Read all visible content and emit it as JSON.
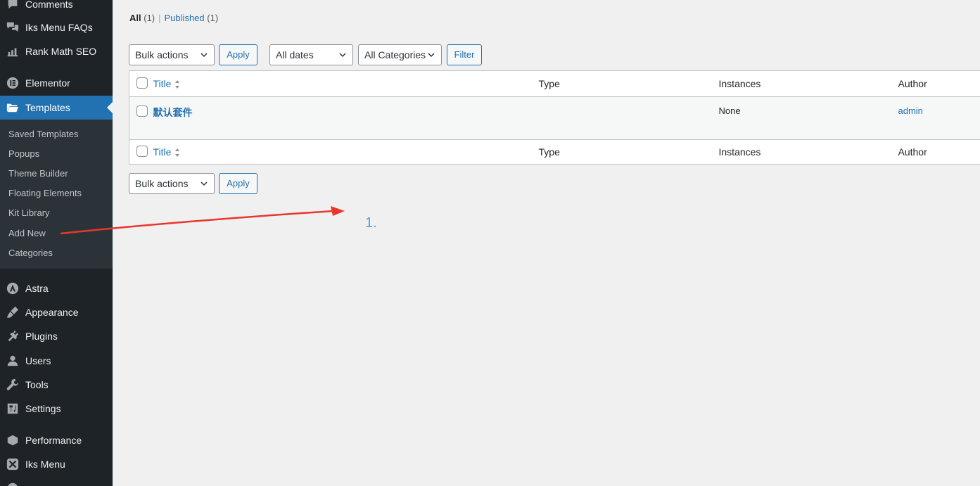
{
  "sidebar": {
    "top_items": [
      {
        "label": "Comments",
        "icon": "comment-icon"
      },
      {
        "label": "Iks Menu FAQs",
        "icon": "faq-icon"
      },
      {
        "label": "Rank Math SEO",
        "icon": "chart-icon"
      }
    ],
    "elementor": {
      "label": "Elementor",
      "icon": "elementor-icon"
    },
    "templates": {
      "label": "Templates",
      "icon": "folder-icon"
    },
    "submenu": [
      "Saved Templates",
      "Popups",
      "Theme Builder",
      "Floating Elements",
      "Kit Library",
      "Add New",
      "Categories"
    ],
    "bottom_items": [
      {
        "label": "Astra",
        "icon": "astra-icon"
      },
      {
        "label": "Appearance",
        "icon": "paintbrush-icon"
      },
      {
        "label": "Plugins",
        "icon": "plugin-icon"
      },
      {
        "label": "Users",
        "icon": "user-icon"
      },
      {
        "label": "Tools",
        "icon": "wrench-icon"
      },
      {
        "label": "Settings",
        "icon": "settings-icon"
      },
      {
        "label": "Performance",
        "icon": "performance-icon"
      },
      {
        "label": "Iks Menu",
        "icon": "iks-menu-icon"
      }
    ]
  },
  "views": {
    "all_label": "All",
    "all_count": "(1)",
    "separator": "|",
    "published_label": "Published",
    "published_count": "(1)"
  },
  "toolbar_top": {
    "bulk_actions": "Bulk actions",
    "apply": "Apply",
    "dates": "All dates",
    "categories": "All Categories",
    "filter": "Filter"
  },
  "table": {
    "columns": {
      "title": "Title",
      "type": "Type",
      "instances": "Instances",
      "author": "Author"
    },
    "rows": [
      {
        "title": "默认套件",
        "type": "",
        "instances": "None",
        "author": "admin"
      }
    ]
  },
  "toolbar_bottom": {
    "bulk_actions": "Bulk actions",
    "apply": "Apply"
  },
  "annotation": {
    "label": "1.",
    "arrow_color": "#e8372c",
    "label_color": "#3fa4de"
  },
  "colors": {
    "sidebar_bg": "#1d2327",
    "accent": "#2271b1",
    "page_bg": "#f0f0f1"
  }
}
